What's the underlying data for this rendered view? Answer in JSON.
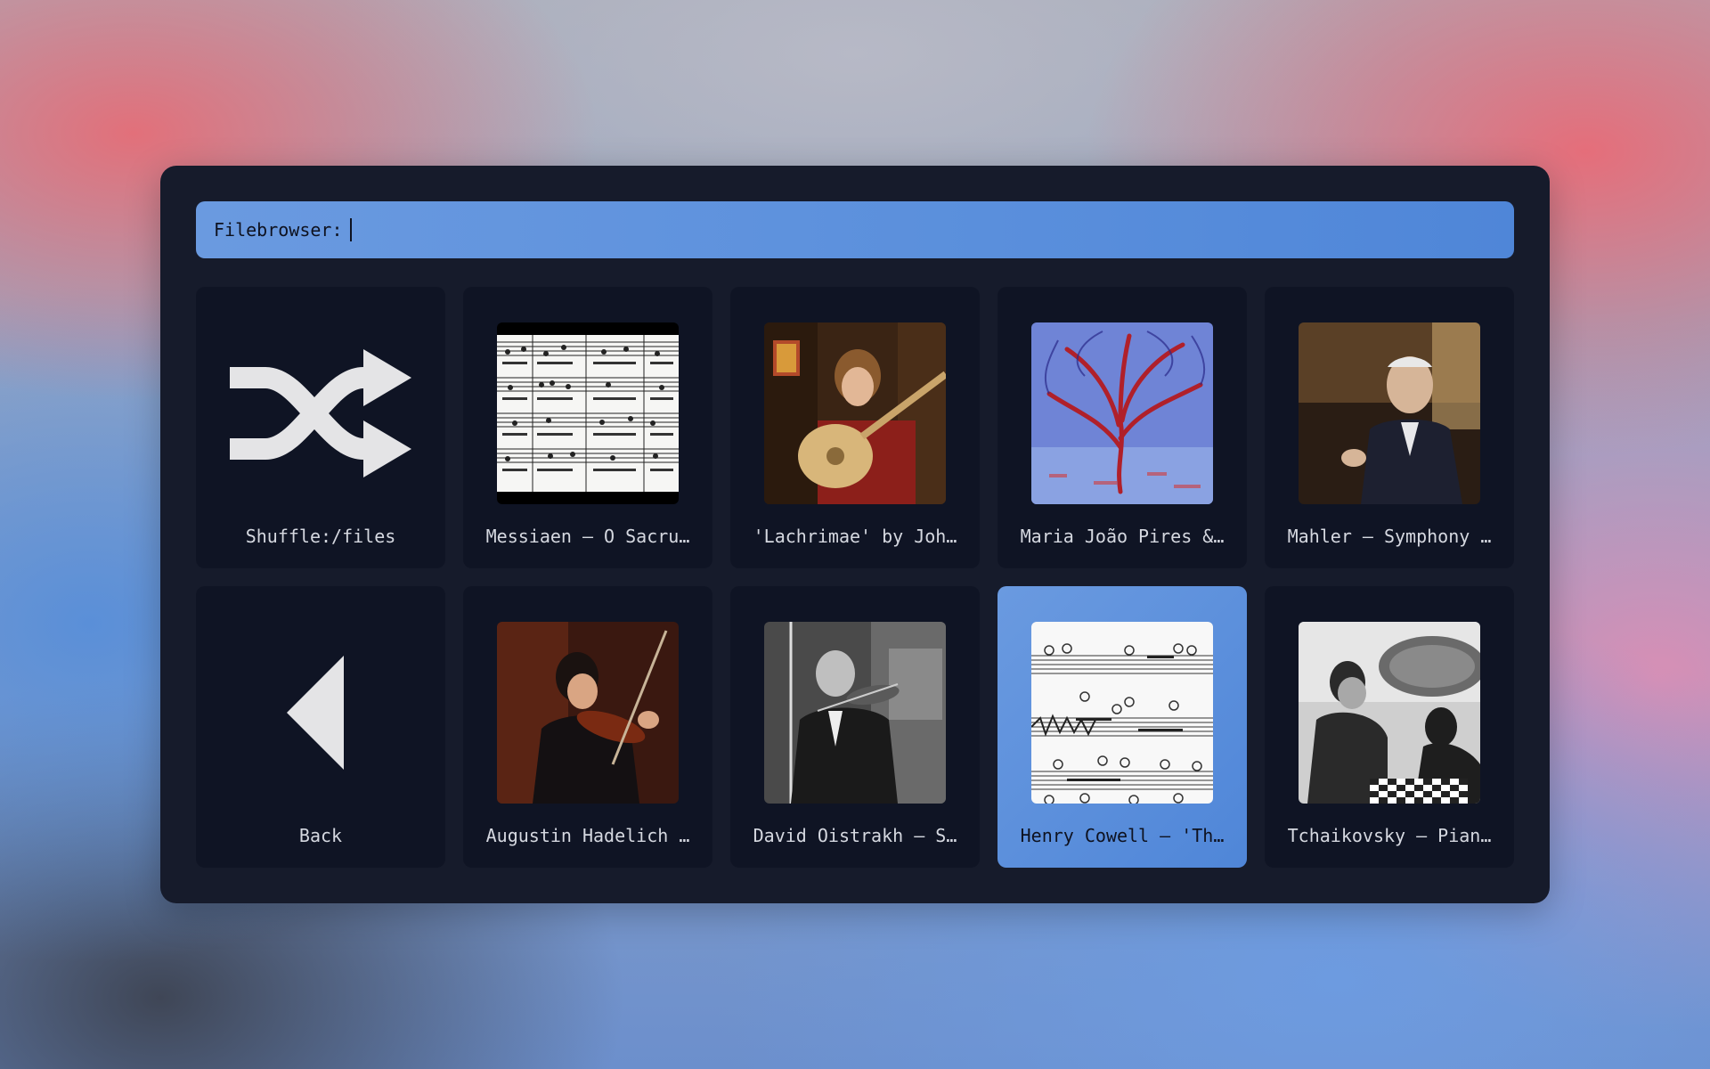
{
  "search": {
    "label": "Filebrowser:",
    "value": ""
  },
  "tiles": [
    {
      "label": "Shuffle:/files",
      "icon": "shuffle-icon"
    },
    {
      "label": "Messiaen – O Sacru…",
      "thumbnail": "sheet-music-thumbnail"
    },
    {
      "label": "'Lachrimae' by Joh…",
      "thumbnail": "lute-player-thumbnail"
    },
    {
      "label": "Maria João Pires &…",
      "thumbnail": "red-tree-painting-thumbnail"
    },
    {
      "label": "Mahler – Symphony …",
      "thumbnail": "conductor-thumbnail"
    },
    {
      "label": "Back",
      "icon": "back-arrow-icon"
    },
    {
      "label": "Augustin Hadelich …",
      "thumbnail": "violinist-thumbnail"
    },
    {
      "label": "David Oistrakh – S…",
      "thumbnail": "bw-violinist-thumbnail"
    },
    {
      "label": "Henry Cowell – 'Th…",
      "thumbnail": "score-thumbnail",
      "selected": true
    },
    {
      "label": "Tchaikovsky – Pian…",
      "thumbnail": "chess-players-thumbnail"
    }
  ],
  "colors": {
    "window_bg": "#161b2b",
    "tile_bg": "#0f1424",
    "accent": "#5a8fdc",
    "label_text": "#d5d8e0"
  }
}
